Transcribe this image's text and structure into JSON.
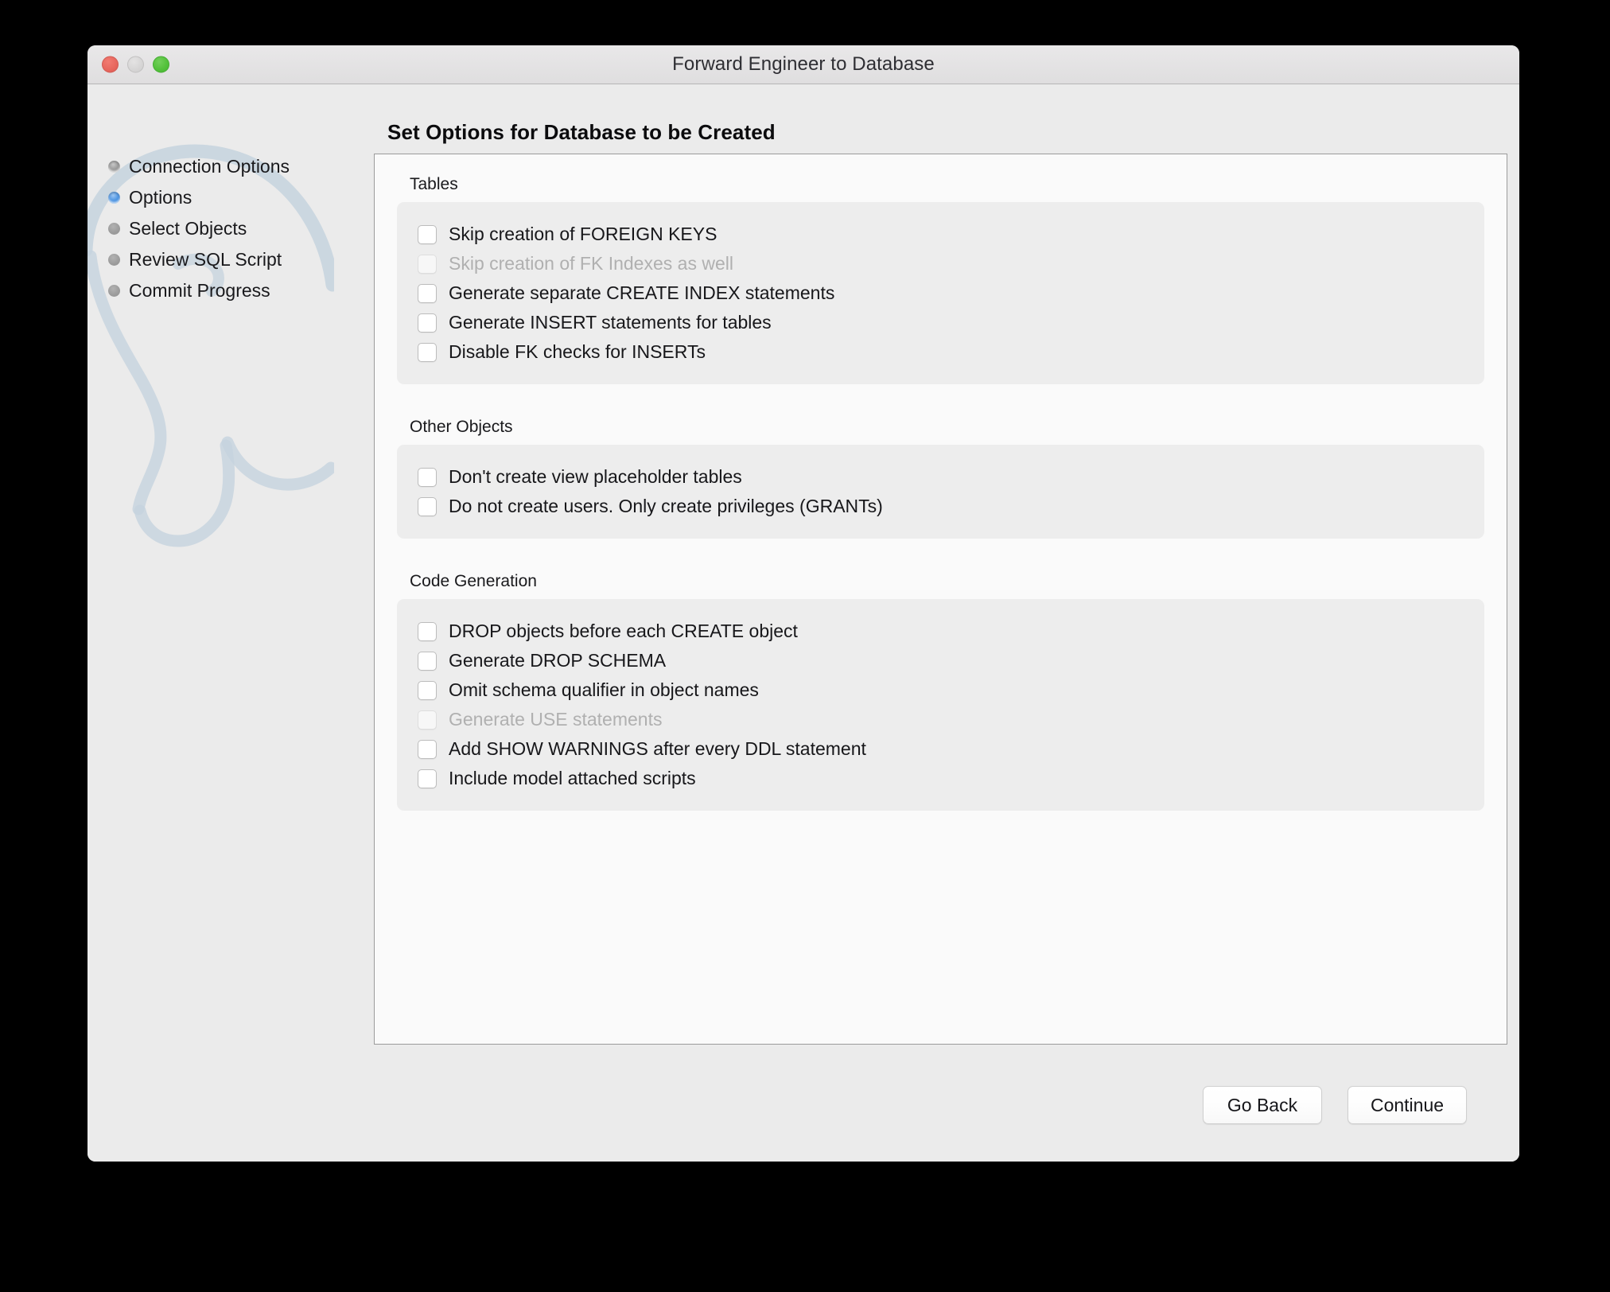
{
  "window": {
    "title": "Forward Engineer to Database",
    "traffic_lights": {
      "close": "close-button",
      "minimize": "minimize-button",
      "maximize": "maximize-button"
    }
  },
  "sidebar": {
    "watermark_icon": "mysql-dolphin-watermark",
    "watermark_color": "#c5d3de",
    "active_color": "#4f96e3",
    "items": [
      {
        "label": "Connection Options",
        "state": "done"
      },
      {
        "label": "Options",
        "state": "active"
      },
      {
        "label": "Select Objects",
        "state": "pending"
      },
      {
        "label": "Review SQL Script",
        "state": "pending"
      },
      {
        "label": "Commit Progress",
        "state": "pending"
      }
    ]
  },
  "main": {
    "page_title": "Set Options for Database to be Created",
    "groups": [
      {
        "label": "Tables",
        "options": [
          {
            "label": "Skip creation of FOREIGN KEYS",
            "checked": false,
            "disabled": false
          },
          {
            "label": "Skip creation of FK Indexes as well",
            "checked": false,
            "disabled": true
          },
          {
            "label": "Generate separate CREATE INDEX statements",
            "checked": false,
            "disabled": false
          },
          {
            "label": "Generate INSERT statements for tables",
            "checked": false,
            "disabled": false
          },
          {
            "label": "Disable FK checks for INSERTs",
            "checked": false,
            "disabled": false
          }
        ]
      },
      {
        "label": "Other Objects",
        "options": [
          {
            "label": "Don't create view placeholder tables",
            "checked": false,
            "disabled": false
          },
          {
            "label": "Do not create users. Only create privileges (GRANTs)",
            "checked": false,
            "disabled": false
          }
        ]
      },
      {
        "label": "Code Generation",
        "options": [
          {
            "label": "DROP objects before each CREATE object",
            "checked": false,
            "disabled": false
          },
          {
            "label": "Generate DROP SCHEMA",
            "checked": false,
            "disabled": false
          },
          {
            "label": "Omit schema qualifier in object names",
            "checked": false,
            "disabled": false
          },
          {
            "label": "Generate USE statements",
            "checked": false,
            "disabled": true
          },
          {
            "label": "Add SHOW WARNINGS after every DDL statement",
            "checked": false,
            "disabled": false
          },
          {
            "label": "Include model attached scripts",
            "checked": false,
            "disabled": false
          }
        ]
      }
    ]
  },
  "footer": {
    "go_back_label": "Go Back",
    "continue_label": "Continue"
  }
}
